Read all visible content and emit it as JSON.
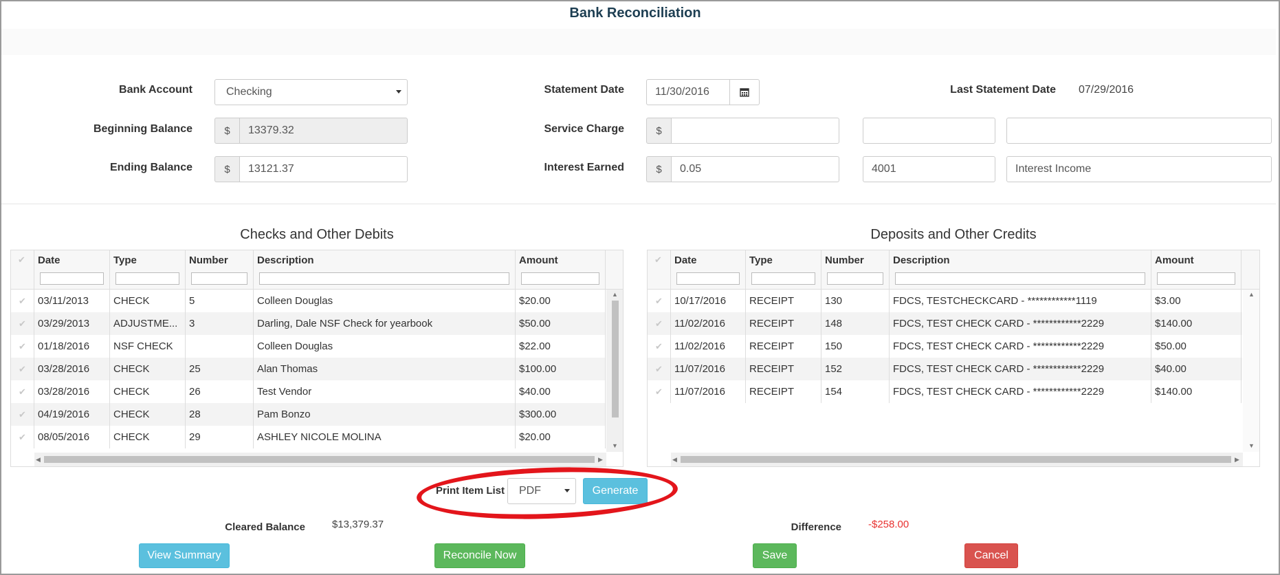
{
  "page": {
    "title": "Bank Reconciliation"
  },
  "form": {
    "bank_account_label": "Bank Account",
    "bank_account_value": "Checking",
    "beginning_balance_label": "Beginning Balance",
    "beginning_balance_value": "13379.32",
    "ending_balance_label": "Ending Balance",
    "ending_balance_value": "13121.37",
    "currency_symbol": "$",
    "statement_date_label": "Statement Date",
    "statement_date_value": "11/30/2016",
    "service_charge_label": "Service Charge",
    "service_charge_value": "",
    "service_charge_account": "",
    "service_charge_account_name": "",
    "interest_earned_label": "Interest Earned",
    "interest_earned_value": "0.05",
    "interest_account": "4001",
    "interest_account_name": "Interest Income",
    "last_statement_date_label": "Last Statement Date",
    "last_statement_date_value": "07/29/2016"
  },
  "checks": {
    "title": "Checks and Other Debits",
    "columns": [
      "Date",
      "Type",
      "Number",
      "Description",
      "Amount"
    ],
    "rows": [
      [
        "03/11/2013",
        "CHECK",
        "5",
        "Colleen Douglas",
        "$20.00"
      ],
      [
        "03/29/2013",
        "ADJUSTME...",
        "3",
        "Darling, Dale NSF Check for yearbook",
        "$50.00"
      ],
      [
        "01/18/2016",
        "NSF CHECK",
        "",
        "Colleen Douglas",
        "$22.00"
      ],
      [
        "03/28/2016",
        "CHECK",
        "25",
        "Alan Thomas",
        "$100.00"
      ],
      [
        "03/28/2016",
        "CHECK",
        "26",
        "Test Vendor",
        "$40.00"
      ],
      [
        "04/19/2016",
        "CHECK",
        "28",
        "Pam Bonzo",
        "$300.00"
      ],
      [
        "08/05/2016",
        "CHECK",
        "29",
        "ASHLEY NICOLE MOLINA",
        "$20.00"
      ]
    ]
  },
  "deposits": {
    "title": "Deposits and Other Credits",
    "columns": [
      "Date",
      "Type",
      "Number",
      "Description",
      "Amount"
    ],
    "rows": [
      [
        "10/17/2016",
        "RECEIPT",
        "130",
        "FDCS, TESTCHECKCARD - ************1119",
        "$3.00"
      ],
      [
        "11/02/2016",
        "RECEIPT",
        "148",
        "FDCS, TEST CHECK CARD - ************2229",
        "$140.00"
      ],
      [
        "11/02/2016",
        "RECEIPT",
        "150",
        "FDCS, TEST CHECK CARD - ************2229",
        "$50.00"
      ],
      [
        "11/07/2016",
        "RECEIPT",
        "152",
        "FDCS, TEST CHECK CARD - ************2229",
        "$40.00"
      ],
      [
        "11/07/2016",
        "RECEIPT",
        "154",
        "FDCS, TEST CHECK CARD - ************2229",
        "$140.00"
      ]
    ]
  },
  "print": {
    "label": "Print Item List",
    "format_value": "PDF",
    "generate_label": "Generate"
  },
  "summary": {
    "cleared_balance_label": "Cleared Balance",
    "cleared_balance_value": "$13,379.37",
    "difference_label": "Difference",
    "difference_value": "-$258.00",
    "difference_color": "#e8312f"
  },
  "actions": {
    "view_summary": "View Summary",
    "reconcile_now": "Reconcile Now",
    "save": "Save",
    "cancel": "Cancel"
  },
  "icons": {
    "calendar": "calendar-icon",
    "checkmark": "checkmark-icon"
  }
}
